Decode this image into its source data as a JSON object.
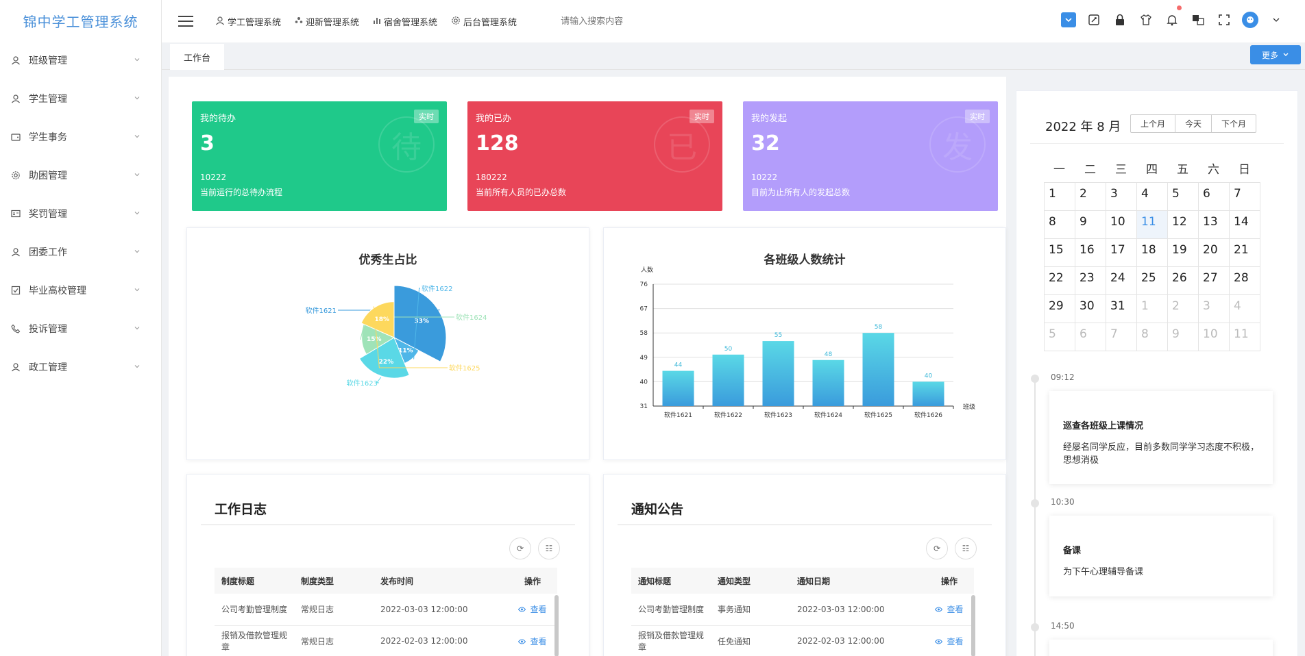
{
  "app": {
    "title": "锦中学工管理系统"
  },
  "sidebar": {
    "items": [
      {
        "label": "班级管理",
        "icon": "user-icon"
      },
      {
        "label": "学生管理",
        "icon": "user-icon"
      },
      {
        "label": "学生事务",
        "icon": "wallet-icon"
      },
      {
        "label": "助困管理",
        "icon": "gear-icon"
      },
      {
        "label": "奖罚管理",
        "icon": "id-card-icon"
      },
      {
        "label": "团委工作",
        "icon": "user-icon"
      },
      {
        "label": "毕业高校管理",
        "icon": "checkbox-icon"
      },
      {
        "label": "投诉管理",
        "icon": "phone-icon"
      },
      {
        "label": "政工管理",
        "icon": "user-icon"
      }
    ]
  },
  "topbar": {
    "nav": [
      {
        "label": "学工管理系统",
        "icon": "user-icon"
      },
      {
        "label": "迎新管理系统",
        "icon": "people-icon"
      },
      {
        "label": "宿舍管理系统",
        "icon": "bar-chart-icon"
      },
      {
        "label": "后台管理系统",
        "icon": "gear-icon"
      }
    ],
    "search_placeholder": "请输入搜索内容"
  },
  "tabs": {
    "current": "工作台",
    "more": "更多"
  },
  "cards": [
    {
      "title": "我的待办",
      "value": "3",
      "num": "10222",
      "desc": "当前运行的总待办流程",
      "tag": "实时",
      "glyph": "待",
      "color": "#1fc98a"
    },
    {
      "title": "我的已办",
      "value": "128",
      "num": "180222",
      "desc": "当前所有人员的已办总数",
      "tag": "实时",
      "glyph": "已",
      "color": "#e84558"
    },
    {
      "title": "我的发起",
      "value": "32",
      "num": "10222",
      "desc": "目前为止所有人的发起总数",
      "tag": "实时",
      "glyph": "发",
      "color": "#b39dfb"
    }
  ],
  "chart_data": [
    {
      "type": "pie",
      "title": "优秀生占比",
      "slices": [
        {
          "name": "软件1621",
          "value": 32,
          "color": "#3a9bdc"
        },
        {
          "name": "软件1622",
          "value": 11,
          "color": "#4fb6e8"
        },
        {
          "name": "软件1623",
          "value": 22,
          "color": "#5ad8e6"
        },
        {
          "name": "软件1624",
          "value": 15,
          "color": "#9fe3b8"
        },
        {
          "name": "软件1625",
          "value": 18,
          "color": "#fdd85d"
        }
      ]
    },
    {
      "type": "bar",
      "title": "各班级人数统计",
      "ylabel": "人数",
      "xlabel": "班级",
      "categories": [
        "软件1621",
        "软件1622",
        "软件1623",
        "软件1624",
        "软件1625",
        "软件1626"
      ],
      "values": [
        44,
        50,
        55,
        48,
        58,
        40
      ],
      "ylim": [
        31,
        76
      ],
      "yticks": [
        31,
        40,
        49,
        58,
        67,
        76
      ],
      "grid": true
    }
  ],
  "worklog": {
    "title": "工作日志",
    "headers": [
      "制度标题",
      "制度类型",
      "发布时间",
      "操作"
    ],
    "rows": [
      [
        "公司考勤管理制度",
        "常规日志",
        "2022-03-03 12:00:00",
        "查看"
      ],
      [
        "报销及借款管理规章",
        "常规日志",
        "2022-02-03 12:00:00",
        "查看"
      ]
    ]
  },
  "notices": {
    "title": "通知公告",
    "headers": [
      "通知标题",
      "通知类型",
      "通知日期",
      "操作"
    ],
    "rows": [
      [
        "公司考勤管理制度",
        "事务通知",
        "2022-03-03 12:00:00",
        "查看"
      ],
      [
        "报销及借款管理规章",
        "任免通知",
        "2022-02-03 12:00:00",
        "查看"
      ]
    ]
  },
  "calendar": {
    "title": "2022 年 8 月",
    "buttons": [
      "上个月",
      "今天",
      "下个月"
    ],
    "weekdays": [
      "一",
      "二",
      "三",
      "四",
      "五",
      "六",
      "日"
    ],
    "days": [
      "1",
      "2",
      "3",
      "4",
      "5",
      "6",
      "7",
      "8",
      "9",
      "10",
      "11",
      "12",
      "13",
      "14",
      "15",
      "16",
      "17",
      "18",
      "19",
      "20",
      "21",
      "22",
      "23",
      "24",
      "25",
      "26",
      "27",
      "28",
      "29",
      "30",
      "31",
      "1",
      "2",
      "3",
      "4",
      "5",
      "6",
      "7",
      "8",
      "9",
      "10",
      "11"
    ],
    "other_month_from": 31,
    "today_index": 10
  },
  "timeline": [
    {
      "time": "09:12",
      "title": "巡查各班级上课情况",
      "body": "经屡名同学反应，目前多数同学学习态度不积极，思想消极"
    },
    {
      "time": "10:30",
      "title": "备课",
      "body": "为下午心理辅导备课"
    },
    {
      "time": "14:50",
      "title": "",
      "body": ""
    }
  ]
}
